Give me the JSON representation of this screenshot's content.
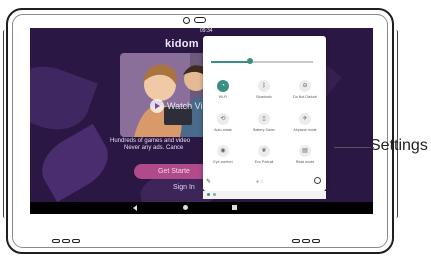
{
  "status_bar": {
    "time": "09:34"
  },
  "app": {
    "brand": "kidom",
    "watch_video_label": "Watch Vi",
    "tagline_line1": "Hundreds of games and video",
    "tagline_line2": "Never any ads. Cance",
    "get_started_label": "Get Starte",
    "sign_in_label": "Sign In"
  },
  "quick_settings": {
    "brightness": 0.38,
    "tiles": [
      {
        "label": "Wi-Fi",
        "icon": "wifi-icon",
        "on": true
      },
      {
        "label": "Bluetooth",
        "icon": "bluetooth-icon",
        "on": false
      },
      {
        "label": "Do Not Disturb",
        "icon": "do-not-disturb-icon",
        "on": false
      },
      {
        "label": "Auto-rotate",
        "icon": "auto-rotate-icon",
        "on": false
      },
      {
        "label": "Battery Saver",
        "icon": "battery-icon",
        "on": false
      },
      {
        "label": "Airplane mode",
        "icon": "airplane-icon",
        "on": false
      },
      {
        "label": "Eye comfort",
        "icon": "eye-icon",
        "on": false
      },
      {
        "label": "Eco Portrait",
        "icon": "eco-icon",
        "on": false
      },
      {
        "label": "Read mode",
        "icon": "read-mode-icon",
        "on": false
      }
    ]
  },
  "callout": {
    "label": "Settings"
  },
  "colors": {
    "screen_bg": "#2a1743",
    "accent": "#3a8f82",
    "button": "#b14a8a"
  }
}
